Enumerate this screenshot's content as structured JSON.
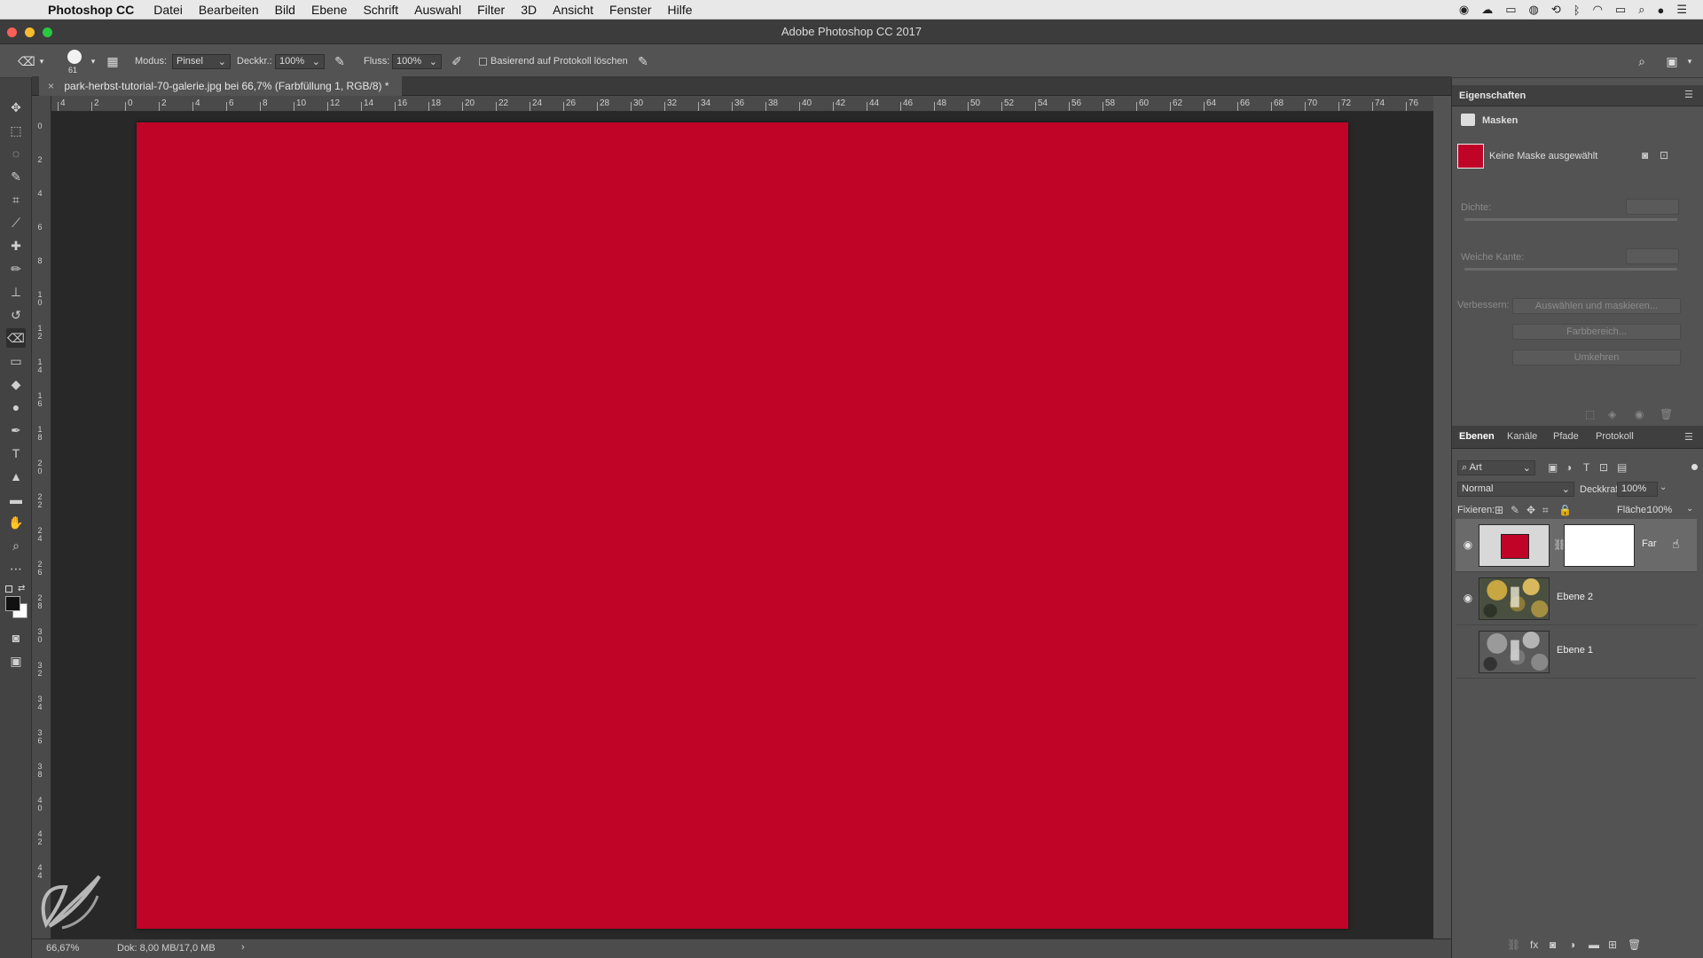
{
  "menubar": {
    "apple": "",
    "app_name": "Photoshop CC",
    "items": [
      "Datei",
      "Bearbeiten",
      "Bild",
      "Ebene",
      "Schrift",
      "Auswahl",
      "Filter",
      "3D",
      "Ansicht",
      "Fenster",
      "Hilfe"
    ]
  },
  "window": {
    "title": "Adobe Photoshop CC 2017"
  },
  "options_bar": {
    "brush_size": "61",
    "modus_label": "Modus:",
    "modus_value": "Pinsel",
    "deckkr_label": "Deckkr.:",
    "deckkr_value": "100%",
    "fluss_label": "Fluss:",
    "fluss_value": "100%",
    "protokoll_label": "Basierend auf Protokoll löschen"
  },
  "document": {
    "tab_title": "park-herbst-tutorial-70-galerie.jpg bei 66,7% (Farbfüllung 1, RGB/8) *",
    "fill_color": "#bf0428",
    "zoom": "66,67%",
    "doc_size": "Dok: 8,00 MB/17,0 MB"
  },
  "ruler_top_labels": [
    "4",
    "2",
    "0",
    "2",
    "4",
    "6",
    "8",
    "10",
    "12",
    "14",
    "16",
    "18",
    "20",
    "22",
    "24",
    "26",
    "28",
    "30",
    "32",
    "34",
    "36",
    "38",
    "40",
    "42",
    "44",
    "46",
    "48",
    "50",
    "52",
    "54",
    "56",
    "58",
    "60",
    "62",
    "64",
    "66",
    "68",
    "70",
    "72",
    "74",
    "76"
  ],
  "ruler_left_labels": [
    "0",
    "2",
    "4",
    "6",
    "8",
    "10",
    "12",
    "14",
    "16",
    "18",
    "20",
    "22",
    "24",
    "26",
    "28",
    "30",
    "32",
    "34",
    "36",
    "38",
    "40",
    "42",
    "44"
  ],
  "properties": {
    "title": "Eigenschaften",
    "section": "Masken",
    "mask_status": "Keine Maske ausgewählt",
    "dichte_label": "Dichte:",
    "kante_label": "Weiche Kante:",
    "verbessern_label": "Verbessern:",
    "btn_select_mask": "Auswählen und maskieren...",
    "btn_color_range": "Farbbereich...",
    "btn_invert": "Umkehren"
  },
  "layers_panel": {
    "tabs": [
      "Ebenen",
      "Kanäle",
      "Pfade",
      "Protokoll"
    ],
    "filter_label": "Art",
    "blend_mode": "Normal",
    "opacity_label": "Deckkraft:",
    "opacity_value": "100%",
    "lock_label": "Fixieren:",
    "fill_label": "Fläche:",
    "fill_value": "100%",
    "layers": [
      {
        "name": "Far",
        "visible": true,
        "selected": true
      },
      {
        "name": "Ebene 2",
        "visible": true,
        "selected": false
      },
      {
        "name": "Ebene 1",
        "visible": false,
        "selected": false
      }
    ]
  },
  "colors": {
    "accent_red": "#bf0428",
    "panel_bg": "#535353"
  }
}
